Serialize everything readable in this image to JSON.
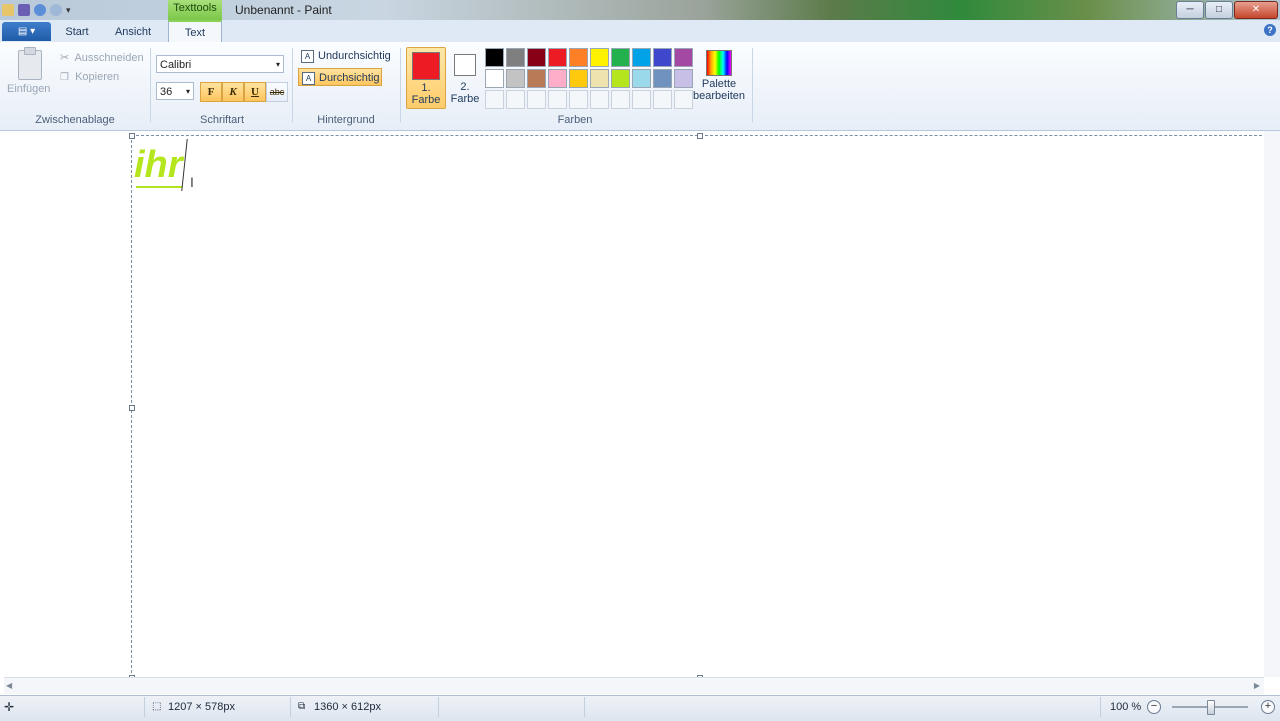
{
  "window": {
    "title": "Unbenannt - Paint",
    "context_tab": "Texttools",
    "buttons": {
      "minimize": "─",
      "maximize": "□",
      "close": "✕"
    }
  },
  "menu": {
    "app_button": "▤ ▾",
    "tabs": [
      {
        "label": "Start"
      },
      {
        "label": "Ansicht"
      },
      {
        "label": "Text"
      }
    ],
    "help": "?"
  },
  "clipboard": {
    "paste": "Einfügen",
    "cut": "Ausschneiden",
    "copy": "Kopieren",
    "group": "Zwischenablage"
  },
  "font": {
    "family": "Calibri",
    "size": "36",
    "bold": "F",
    "italic": "K",
    "underline": "U",
    "strike": "abc",
    "group": "Schriftart"
  },
  "background": {
    "opaque": "Undurchsichtig",
    "transparent": "Durchsichtig",
    "group": "Hintergrund"
  },
  "colors": {
    "color1_label": "1. Farbe",
    "color1_value": "#ed1c24",
    "color2_label": "2. Farbe",
    "color2_value": "#ffffff",
    "edit_palette": "Palette bearbeiten",
    "group": "Farben",
    "palette": [
      "#000000",
      "#7f7f7f",
      "#880015",
      "#ed1c24",
      "#ff7f27",
      "#fff200",
      "#22b14c",
      "#00a2e8",
      "#3f48cc",
      "#a349a4",
      "#ffffff",
      "#c3c3c3",
      "#b97a57",
      "#ffaec9",
      "#ffc90e",
      "#efe4b0",
      "#b5e61d",
      "#99d9ea",
      "#7092be",
      "#c8bfe7",
      "#ffffff",
      "#ffffff",
      "#ffffff",
      "#ffffff",
      "#ffffff",
      "#ffffff",
      "#ffffff",
      "#ffffff",
      "#ffffff",
      "#ffffff"
    ]
  },
  "canvas": {
    "text": "ihr",
    "text_color": "#b5e61d"
  },
  "status": {
    "selection_size": "1207 × 578px",
    "image_size": "1360 × 612px",
    "zoom": "100 %"
  }
}
